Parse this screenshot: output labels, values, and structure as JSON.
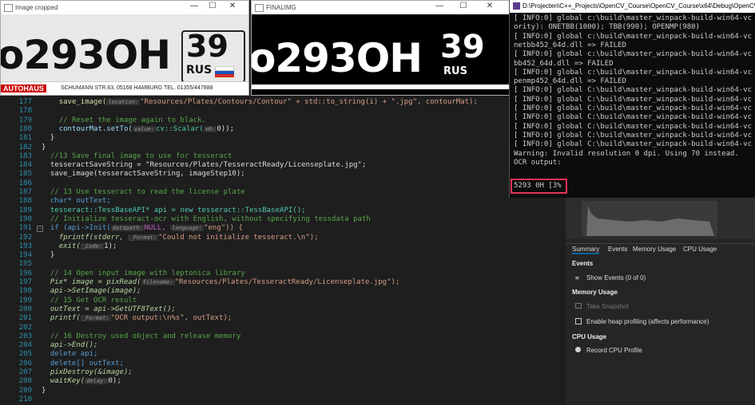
{
  "windows": {
    "cropped": {
      "title": "Image cropped",
      "plate_text": "o293OH",
      "region": "39",
      "country": "RUS",
      "dealer_bar": "AUTOHAUS",
      "dealer_addr": "SCHUMANN STR.63, 05168 HAMBURG TEL. 01355/447888"
    },
    "final": {
      "title": "FINALIMG",
      "plate_text": "o293OH",
      "region": "39",
      "country": "RUS"
    }
  },
  "console": {
    "title": "D:\\Projecten\\C++_Projects\\OpenCV_Course\\OpenCV_Course\\x64\\Debug\\OpenCV_",
    "lines": [
      "[ INFO:0] global c:\\build\\master_winpack-build-win64-vc",
      "ority): ONETBB(1000); TBB(990); OPENMP(980)",
      "[ INFO:0] global c:\\build\\master_winpack-build-win64-vc",
      "netbb452_64d.dll => FAILED",
      "[ INFO:0] global c:\\build\\master_winpack-build-win64-vc",
      "bb452_64d.dll => FAILED",
      "[ INFO:0] global c:\\build\\master_winpack-build-win64-vc",
      "penmp452_64d.dll => FAILED",
      "[ INFO:0] global C:\\build\\master_winpack-build-win64-vc",
      "[ INFO:0] global C:\\build\\master_winpack-build-win64-vc",
      "[ INFO:0] global C:\\build\\master_winpack-build-win64-vc",
      "[ INFO:0] global C:\\build\\master_winpack-build-win64-vc",
      "[ INFO:0] global C:\\build\\master_winpack-build-win64-vc",
      "[ INFO:0] global C:\\build\\master_winpack-build-win64-vc",
      "[ INFO:0] global C:\\build\\master_winpack-build-win64-vc",
      "Warning: Invalid resolution 0 dpi. Using 70 instead.",
      "OCR output:",
      "5293 0H [3%"
    ]
  },
  "diagnostics": {
    "tabs": [
      "Summary",
      "Events",
      "Memory Usage",
      "CPU Usage"
    ],
    "events_header": "Events",
    "show_events": "Show Events (0 of 0)",
    "memory_header": "Memory Usage",
    "take_snapshot": "Take Snapshot",
    "heap_profiling": "Enable heap profiling (affects performance)",
    "cpu_header": "CPU Usage",
    "record_cpu": "Record CPU Profile"
  },
  "code": {
    "line_numbers": [
      "177",
      "178",
      "179",
      "180",
      "181",
      "182",
      "183",
      "184",
      "185",
      "186",
      "187",
      "188",
      "189",
      "190",
      "191",
      "192",
      "193",
      "194",
      "195",
      "196",
      "197",
      "198",
      "199",
      "200",
      "201",
      "202",
      "203",
      "204",
      "205",
      "206",
      "207",
      "208",
      "209",
      "210"
    ],
    "l177": "save_image(",
    "l177b": "\"Resources/Plates/Contours/Contour\" + std::to_string(i) + \".jpg\", contourMat);",
    "l179": "// Reset the image again to black.",
    "l180": "contourMat.setTo(",
    "l180b": "cv::Scalar(",
    "l180c": "0));",
    "l183": "//13 Save final image to use for tesseract",
    "l184": "tesseractSaveString = \"Resources/Plates/TesseractReady/Licenseplate.jpg\";",
    "l185": "save_image(tesseractSaveString, imageStep10);",
    "l187": "// 13 Use tesseract to read the license plate",
    "l188": "char* outText;",
    "l189": "tesseract::TessBaseAPI* api = new tesseract::TessBaseAPI();",
    "l190": "// Initialize tesseract-ocr with English, without specifying tessdata path",
    "l191": "if (api->Init(",
    "l191b": "NULL,",
    "l191c": "\"eng\")) {",
    "l192": "fprintf(stderr,",
    "l192b": "\"Could not initialize tesseract.\\n\");",
    "l193": "exit(",
    "l193b": "1);",
    "l194": "}",
    "l196": "// 14 Open input image with leptonica library",
    "l197": "Pix* image = pixRead(",
    "l197b": "\"Resources/Plates/TesseractReady/Licenseplate.jpg\");",
    "l198": "api->SetImage(image);",
    "l199": "// 15 Get OCR result",
    "l200": "outText = api->GetUTF8Text();",
    "l201": "printf(",
    "l201b": "\"OCR output:\\n%s\", outText);",
    "l203": "// 16 Destroy used object and release memory",
    "l204": "api->End();",
    "l205": "delete api;",
    "l206": "delete[] outText;",
    "l207": "pixDestroy(&image);",
    "l208": "waitKey(",
    "l208b": "0);",
    "l209": "}",
    "hint_location": "location:",
    "hint_value": "value:",
    "hint_v0": "v0:",
    "hint_datapath": "datapath:",
    "hint_language": "language:",
    "hint_format": "_Format:",
    "hint_code": "_Code:",
    "hint_filename": "filename:",
    "hint_delay": "delay:"
  },
  "colors": {
    "accent_box": "#e8335a",
    "keyword": "#569cd6",
    "comment": "#57a64a",
    "string": "#d69d85"
  }
}
